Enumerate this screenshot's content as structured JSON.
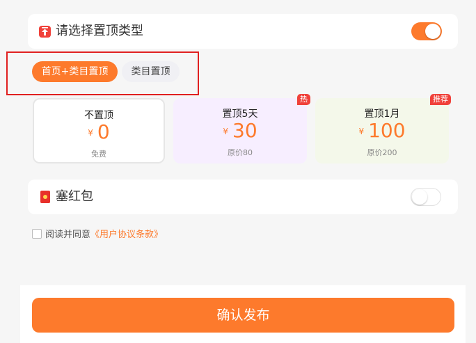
{
  "top_card": {
    "title": "请选择置顶类型",
    "toggle_on": true
  },
  "tabs": [
    {
      "label": "首页+类目置顶",
      "active": true
    },
    {
      "label": "类目置顶",
      "active": false
    }
  ],
  "options": [
    {
      "title": "不置顶",
      "currency": "¥",
      "price": "0",
      "sub": "免费",
      "badge": ""
    },
    {
      "title": "置顶5天",
      "currency": "¥",
      "price": "30",
      "sub": "原价80",
      "badge": "热"
    },
    {
      "title": "置顶1月",
      "currency": "¥",
      "price": "100",
      "sub": "原价200",
      "badge": "推荐"
    }
  ],
  "red_packet": {
    "title": "塞红包",
    "toggle_on": false
  },
  "agreement": {
    "text": "阅读并同意",
    "link": "《用户协议条款》"
  },
  "confirm_label": "确认发布",
  "colors": {
    "accent": "#fd7a2c",
    "badge": "#f0413a"
  }
}
